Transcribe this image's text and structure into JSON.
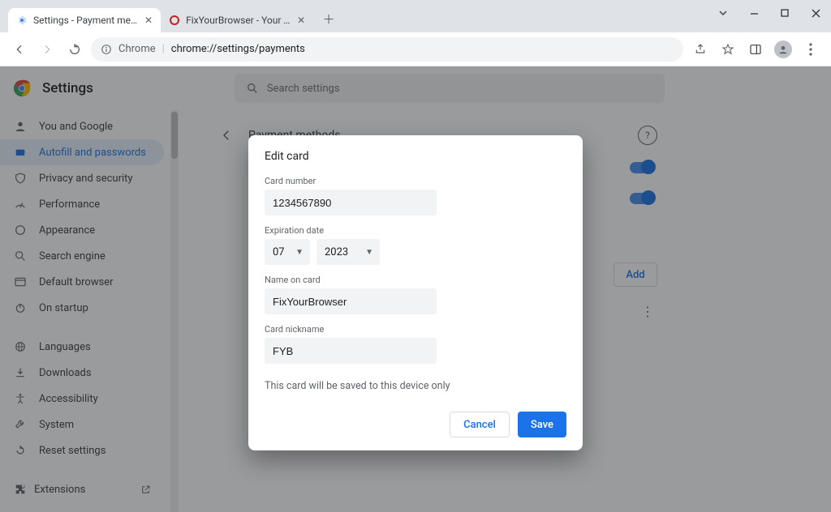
{
  "window": {
    "tabs": [
      {
        "title": "Settings - Payment methods",
        "favicon": "settings-gear"
      },
      {
        "title": "FixYourBrowser - Your Trusted Sc",
        "favicon": "circle-o"
      }
    ]
  },
  "omnibox": {
    "host_label": "Chrome",
    "url": "chrome://settings/payments"
  },
  "settings": {
    "title": "Settings",
    "search_placeholder": "Search settings"
  },
  "sidebar": [
    {
      "icon": "person",
      "label": "You and Google"
    },
    {
      "icon": "key",
      "label": "Autofill and passwords",
      "selected": true
    },
    {
      "icon": "shield",
      "label": "Privacy and security"
    },
    {
      "icon": "speed",
      "label": "Performance"
    },
    {
      "icon": "palette",
      "label": "Appearance"
    },
    {
      "icon": "search",
      "label": "Search engine"
    },
    {
      "icon": "browser",
      "label": "Default browser"
    },
    {
      "icon": "power",
      "label": "On startup"
    }
  ],
  "sidebar2": [
    {
      "icon": "globe",
      "label": "Languages"
    },
    {
      "icon": "download",
      "label": "Downloads"
    },
    {
      "icon": "accessibility",
      "label": "Accessibility"
    },
    {
      "icon": "wrench",
      "label": "System"
    },
    {
      "icon": "reset",
      "label": "Reset settings"
    }
  ],
  "sidebar3": [
    {
      "icon": "puzzle",
      "label": "Extensions"
    }
  ],
  "section": {
    "title": "Payment methods",
    "add_label": "Add"
  },
  "dialog": {
    "title": "Edit card",
    "card_number_label": "Card number",
    "card_number_value": "1234567890",
    "exp_label": "Expiration date",
    "exp_month": "07",
    "exp_year": "2023",
    "name_label": "Name on card",
    "name_value": "FixYourBrowser",
    "nickname_label": "Card nickname",
    "nickname_value": "FYB",
    "note": "This card will be saved to this device only",
    "cancel": "Cancel",
    "save": "Save"
  }
}
